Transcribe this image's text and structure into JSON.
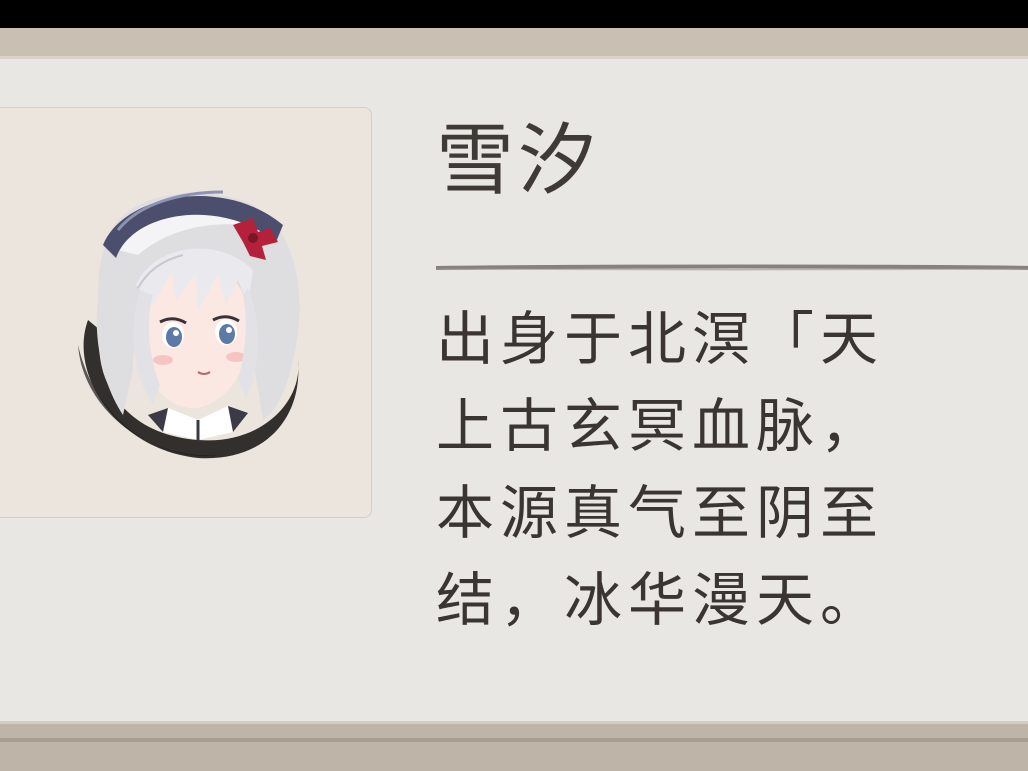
{
  "character": {
    "name": "雪汐",
    "description_lines": [
      "出身于北溟「天",
      "上古玄冥血脉，",
      "本源真气至阴至",
      "结，冰华漫天。"
    ]
  },
  "colors": {
    "panel_background": "#e9e7e3",
    "frame": "#c9bfb3",
    "text": "#3a3532",
    "hair_accent": "#b3223a"
  }
}
